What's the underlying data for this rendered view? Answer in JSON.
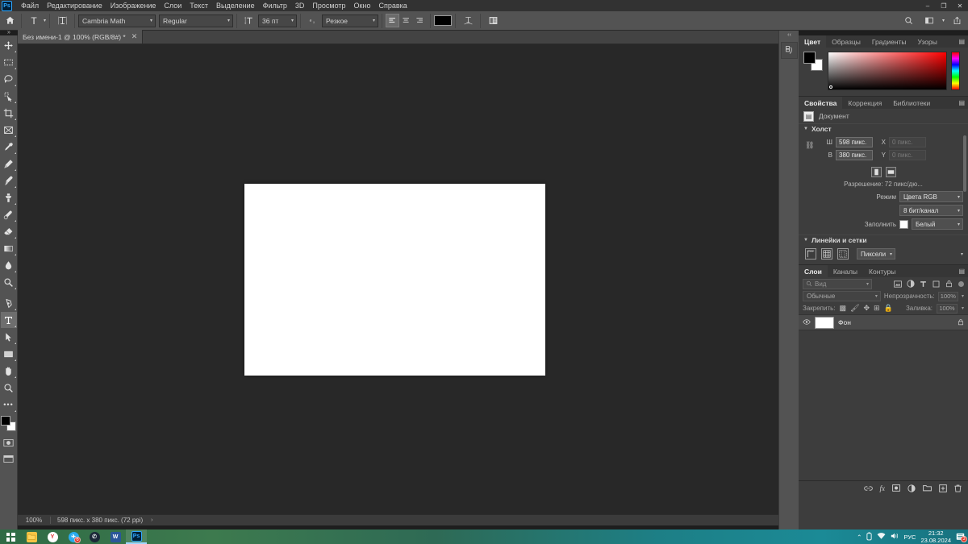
{
  "app": {
    "logo": "ps-logo",
    "logo_text": "Ps",
    "menus": [
      "Файл",
      "Редактирование",
      "Изображение",
      "Слои",
      "Текст",
      "Выделение",
      "Фильтр",
      "3D",
      "Просмотр",
      "Окно",
      "Справка"
    ],
    "window_controls": [
      "‒",
      "❐",
      "✕"
    ]
  },
  "options_bar": {
    "home_icon": "home-icon",
    "tool_icon": "type-tool-icon",
    "tool_glyph": "T",
    "orientation_icon": "text-orientation-icon",
    "font_family": "Cambria Math",
    "font_style": "Regular",
    "size_icon": "font-size-icon",
    "font_size": "36 пт",
    "aa_icon": "anti-alias-icon",
    "anti_alias": "Резкое",
    "align_left": "align-left-icon",
    "align_center": "align-center-icon",
    "align_right": "align-right-icon",
    "text_color": "#000000",
    "warp_icon": "warp-text-icon",
    "panels_icon": "character-panel-icon",
    "search_icon": "search-icon",
    "workspace_icon": "workspace-icon",
    "share_icon": "share-icon"
  },
  "toolbar": {
    "collapse": "»",
    "tools": [
      {
        "name": "move-tool",
        "glyph": "✥",
        "has_menu": true,
        "active": false
      },
      {
        "name": "rectangular-marquee-tool",
        "glyph": "▭",
        "has_menu": true,
        "active": false
      },
      {
        "name": "lasso-tool",
        "glyph": "◯",
        "has_menu": true,
        "active": false
      },
      {
        "name": "quick-selection-tool",
        "glyph": "◤",
        "has_menu": true,
        "active": false
      },
      {
        "name": "crop-tool",
        "glyph": "⌗",
        "has_menu": true,
        "active": false
      },
      {
        "name": "frame-tool",
        "glyph": "⊠",
        "has_menu": false,
        "active": false
      },
      {
        "name": "eyedropper-tool",
        "glyph": "✎",
        "has_menu": true,
        "active": false
      },
      {
        "name": "spot-healing-brush-tool",
        "glyph": "✒",
        "has_menu": true,
        "active": false
      },
      {
        "name": "brush-tool",
        "glyph": "🖌",
        "has_menu": true,
        "active": false
      },
      {
        "name": "clone-stamp-tool",
        "glyph": "⎙",
        "has_menu": true,
        "active": false
      },
      {
        "name": "history-brush-tool",
        "glyph": "❦",
        "has_menu": true,
        "active": false
      },
      {
        "name": "eraser-tool",
        "glyph": "◣",
        "has_menu": true,
        "active": false
      },
      {
        "name": "gradient-tool",
        "glyph": "▤",
        "has_menu": true,
        "active": false
      },
      {
        "name": "blur-tool",
        "glyph": "💧",
        "has_menu": true,
        "active": false
      },
      {
        "name": "dodge-tool",
        "glyph": "🔍",
        "has_menu": true,
        "active": false
      },
      {
        "name": "pen-tool",
        "glyph": "✐",
        "has_menu": true,
        "active": false
      },
      {
        "name": "type-tool",
        "glyph": "T",
        "has_menu": true,
        "active": true
      },
      {
        "name": "path-selection-tool",
        "glyph": "➤",
        "has_menu": true,
        "active": false
      },
      {
        "name": "rectangle-tool",
        "glyph": "▭",
        "has_menu": true,
        "active": false
      },
      {
        "name": "hand-tool",
        "glyph": "✋",
        "has_menu": true,
        "active": false
      },
      {
        "name": "zoom-tool",
        "glyph": "⌕",
        "has_menu": false,
        "active": false
      },
      {
        "name": "edit-toolbar-button",
        "glyph": "•••",
        "has_menu": false,
        "active": false
      }
    ],
    "foreground_color": "#000000",
    "background_color": "#ffffff",
    "quick_mask_icon": "quick-mask-icon",
    "screen_mode_icon": "screen-mode-icon"
  },
  "document": {
    "tab_title": "Без имени-1 @ 100% (RGB/8#) *",
    "tab_close": "✕",
    "canvas_background": "#ffffff"
  },
  "status_bar": {
    "zoom": "100%",
    "info": "598 пикс. x 380 пикс. (72 ppi)",
    "arrow": "›"
  },
  "right_rail": {
    "collapse": "‹‹",
    "icon": "history-panel-icon"
  },
  "color_panel": {
    "tabs": [
      "Цвет",
      "Образцы",
      "Градиенты",
      "Узоры"
    ],
    "active_tab": "Цвет",
    "menu_icon": "panel-menu-icon",
    "foreground_color": "#000000",
    "background_color": "#ffffff",
    "ramp_color": "#ff0000"
  },
  "properties_panel": {
    "tabs": [
      "Свойства",
      "Коррекция",
      "Библиотеки"
    ],
    "active_tab": "Свойства",
    "menu_icon": "panel-menu-icon",
    "doc_icon": "document-icon",
    "doc_label": "Документ",
    "canvas_section": "Холст",
    "width_label": "Ш",
    "width_value": "598 пикс.",
    "x_label": "X",
    "x_value": "0 пикс.",
    "height_label": "В",
    "height_value": "380 пикс.",
    "y_label": "Y",
    "y_value": "0 пикс.",
    "link_icon": "link-dimensions-icon",
    "portrait_icon": "portrait-orientation-icon",
    "landscape_icon": "landscape-orientation-icon",
    "resolution": "Разрешение: 72 пикс/дю...",
    "mode_label": "Режим",
    "mode_value": "Цвета RGB",
    "depth_value": "8 бит/канал",
    "fill_label": "Заполнить",
    "fill_value": "Белый",
    "fill_color": "#ffffff",
    "rulers_section": "Линейки и сетки",
    "ruler_icon": "rulers-icon",
    "grid_icon": "grid-icon",
    "guides_icon": "guides-icon",
    "units_value": "Пиксели"
  },
  "layers_panel": {
    "tabs": [
      "Слои",
      "Каналы",
      "Контуры"
    ],
    "active_tab": "Слои",
    "menu_icon": "panel-menu-icon",
    "filter_icon": "search-icon",
    "filter_placeholder": "Вид",
    "filter_icons": [
      "pixel-filter-icon",
      "adjustment-filter-icon",
      "type-filter-icon",
      "shape-filter-icon",
      "smart-object-filter-icon"
    ],
    "blend_mode": "Обычные",
    "opacity_label": "Непрозрачность:",
    "opacity_value": "100%",
    "lock_label": "Закрепить:",
    "lock_icons": [
      "lock-transparency-icon",
      "lock-image-icon",
      "lock-position-icon",
      "lock-artboard-icon",
      "lock-all-icon"
    ],
    "fill_label": "Заливка:",
    "fill_value": "100%",
    "layers": [
      {
        "visible": true,
        "eye_icon": "eye-icon",
        "name": "Фон",
        "locked": true,
        "lock_icon": "lock-icon",
        "thumb_color": "#ffffff"
      }
    ],
    "bottom_icons": [
      "link-layers-icon",
      "layer-style-icon",
      "layer-mask-icon",
      "adjustment-layer-icon",
      "new-group-icon",
      "new-layer-icon",
      "delete-layer-icon"
    ],
    "bottom_glyphs": [
      "👁",
      "fx",
      "◨",
      "◐",
      "▰",
      "⊞",
      "🗑"
    ]
  },
  "taskbar": {
    "items": [
      {
        "name": "start-button",
        "label": "",
        "color": "#ffffff",
        "badge": ""
      },
      {
        "name": "file-explorer",
        "label": "",
        "color": "#f6c445",
        "badge": ""
      },
      {
        "name": "yandex-browser",
        "label": "Y",
        "color": "#ffffff",
        "badge": ""
      },
      {
        "name": "telegram",
        "label": "✈",
        "color": "#2aabee",
        "badge": "6"
      },
      {
        "name": "steam",
        "label": "✆",
        "color": "#1b2838",
        "badge": ""
      },
      {
        "name": "word",
        "label": "W",
        "color": "#2b579a",
        "badge": ""
      },
      {
        "name": "photoshop",
        "label": "Ps",
        "color": "#001e36",
        "badge": ""
      }
    ],
    "tray": {
      "chevron": "⌃",
      "battery_icon": "battery-icon",
      "network_icon": "network-icon",
      "volume_icon": "volume-icon",
      "language": "РУС",
      "time": "21:32",
      "date": "23.08.2024",
      "notifications_icon": "notifications-icon",
      "notifications_count": "3"
    }
  }
}
